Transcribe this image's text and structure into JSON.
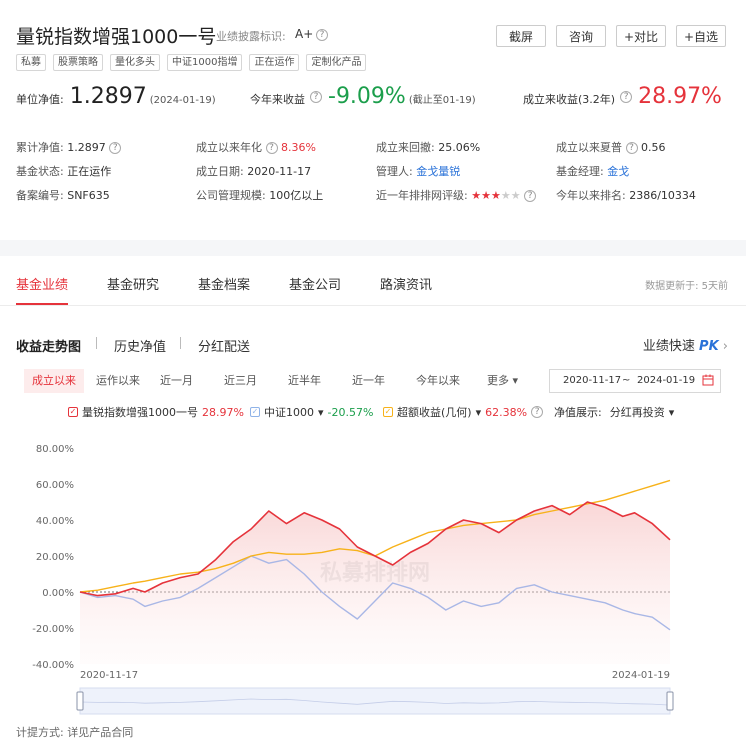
{
  "header": {
    "title": "量锐指数增强1000一号",
    "disclosure_label": "业绩披露标识:",
    "disclosure_value": "A+",
    "buttons": [
      "截屏",
      "咨询",
      "+对比",
      "+自选"
    ],
    "tags": [
      "私募",
      "股票策略",
      "量化多头",
      "中证1000指增",
      "正在运作",
      "定制化产品"
    ]
  },
  "kpis": {
    "nav_label": "单位净值:",
    "nav_value": "1.2897",
    "nav_date": "(2024-01-19)",
    "ytd_label": "今年来收益",
    "ytd_value": "-9.09%",
    "ytd_note": "(截止至01-19)",
    "inception_label": "成立来收益(3.2年)",
    "inception_value": "28.97%"
  },
  "info": [
    {
      "label": "累计净值:",
      "value": "1.2897"
    },
    {
      "label": "成立以来年化",
      "value": "8.36%"
    },
    {
      "label": "成立来回撤:",
      "value": "25.06%"
    },
    {
      "label": "成立以来夏普",
      "value": "0.56"
    },
    {
      "label": "基金状态:",
      "value": "正在运作"
    },
    {
      "label": "成立日期:",
      "value": "2020-11-17"
    },
    {
      "label": "管理人:",
      "value": "金戈量锐"
    },
    {
      "label": "基金经理:",
      "value": "金戈"
    },
    {
      "label": "备案编号:",
      "value": "SNF635"
    },
    {
      "label": "公司管理规模:",
      "value": "100亿以上"
    },
    {
      "label": "近一年排排网评级:",
      "value": ""
    },
    {
      "label": "今年以来排名:",
      "value": "2386/10334"
    }
  ],
  "rating_stars": 3,
  "rating_max": 5,
  "tabs": [
    "基金业绩",
    "基金研究",
    "基金档案",
    "基金公司",
    "路演资讯"
  ],
  "updated_text": "数据更新于: 5天前",
  "subtabs": [
    "收益走势图",
    "历史净值",
    "分红配送"
  ],
  "quick_label": "业绩快速",
  "quick_pk": "PK",
  "ranges": [
    "成立以来",
    "运作以来",
    "近一月",
    "近三月",
    "近半年",
    "近一年",
    "今年以来",
    "更多"
  ],
  "date_from": "2020-11-17",
  "date_sep": "~",
  "date_to": "2024-01-19",
  "legend": [
    {
      "name": "量锐指数增强1000一号",
      "value": "28.97%",
      "color": "#e5333b"
    },
    {
      "name": "中证1000",
      "value": "-20.57%",
      "color": "#a9b7e6"
    },
    {
      "name": "超额收益(几何)",
      "value": "62.38%",
      "color": "#f7b21a"
    }
  ],
  "nav_display_label": "净值展示:",
  "nav_display_value": "分红再投资",
  "watermark": "私募排排网",
  "footer": "计提方式:  详见产品合同",
  "chart_data": {
    "type": "line",
    "y_ticks": [
      "80.00%",
      "60.00%",
      "40.00%",
      "20.00%",
      "0.00%",
      "-20.00%",
      "-40.00%"
    ],
    "ylim": [
      -40,
      80
    ],
    "x_labels": [
      "2020-11-17",
      "2024-01-19"
    ],
    "x_range": [
      0,
      100
    ],
    "series": [
      {
        "name": "量锐指数增强1000一号",
        "color": "#e5333b",
        "x": [
          0,
          3,
          6,
          9,
          11,
          14,
          17,
          20,
          23,
          26,
          29,
          32,
          35,
          38,
          41,
          44,
          47,
          50,
          53,
          56,
          59,
          62,
          65,
          68,
          71,
          74,
          77,
          80,
          83,
          86,
          89,
          92,
          94,
          97,
          100
        ],
        "values": [
          0,
          -2,
          -1,
          2,
          0,
          5,
          8,
          10,
          18,
          28,
          35,
          45,
          38,
          44,
          40,
          35,
          25,
          20,
          15,
          22,
          27,
          35,
          40,
          38,
          33,
          40,
          45,
          48,
          43,
          50,
          47,
          42,
          44,
          38,
          29
        ]
      },
      {
        "name": "中证1000",
        "color": "#a9b7e6",
        "x": [
          0,
          3,
          6,
          9,
          11,
          14,
          17,
          20,
          23,
          26,
          29,
          32,
          35,
          38,
          41,
          44,
          47,
          50,
          53,
          56,
          59,
          62,
          65,
          68,
          71,
          74,
          77,
          80,
          83,
          86,
          89,
          92,
          94,
          97,
          100
        ],
        "values": [
          0,
          -3,
          -2,
          -4,
          -8,
          -5,
          -3,
          2,
          8,
          14,
          20,
          16,
          18,
          10,
          0,
          -8,
          -15,
          -5,
          5,
          2,
          -3,
          -10,
          -5,
          -8,
          -6,
          2,
          4,
          0,
          -2,
          -4,
          -6,
          -10,
          -12,
          -14,
          -21
        ]
      },
      {
        "name": "超额收益(几何)",
        "color": "#f7b21a",
        "x": [
          0,
          3,
          6,
          9,
          11,
          14,
          17,
          20,
          23,
          26,
          29,
          32,
          35,
          38,
          41,
          44,
          47,
          50,
          53,
          56,
          59,
          62,
          65,
          68,
          71,
          74,
          77,
          80,
          83,
          86,
          89,
          92,
          94,
          97,
          100
        ],
        "values": [
          0,
          1,
          3,
          5,
          6,
          8,
          10,
          11,
          13,
          16,
          20,
          22,
          21,
          21,
          22,
          24,
          23,
          20,
          25,
          29,
          33,
          35,
          37,
          38,
          39,
          40,
          43,
          45,
          47,
          49,
          51,
          54,
          56,
          59,
          62
        ]
      }
    ]
  }
}
